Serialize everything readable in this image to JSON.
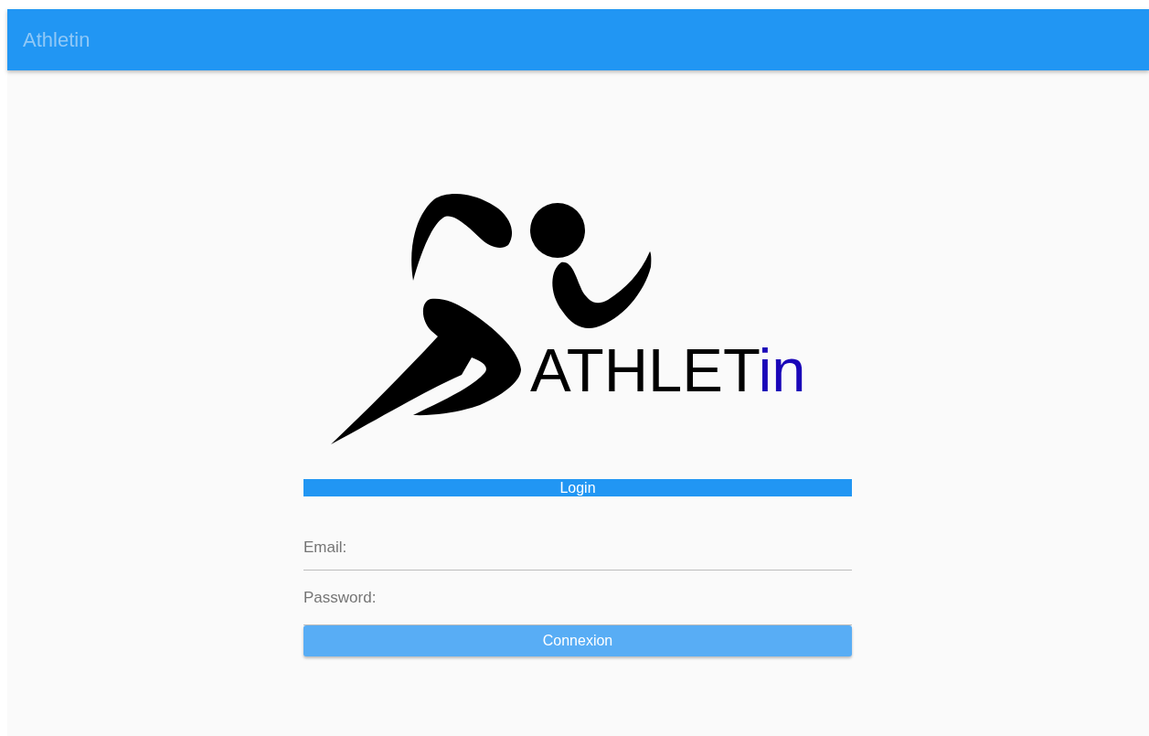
{
  "app_bar": {
    "title": "Athletin"
  },
  "logo": {
    "text": "ATHLET",
    "accent": "in"
  },
  "login_header": "Login",
  "fields": [
    {
      "placeholder": "Email:"
    },
    {
      "placeholder": "Password:"
    }
  ],
  "submit_button": "Connexion"
}
